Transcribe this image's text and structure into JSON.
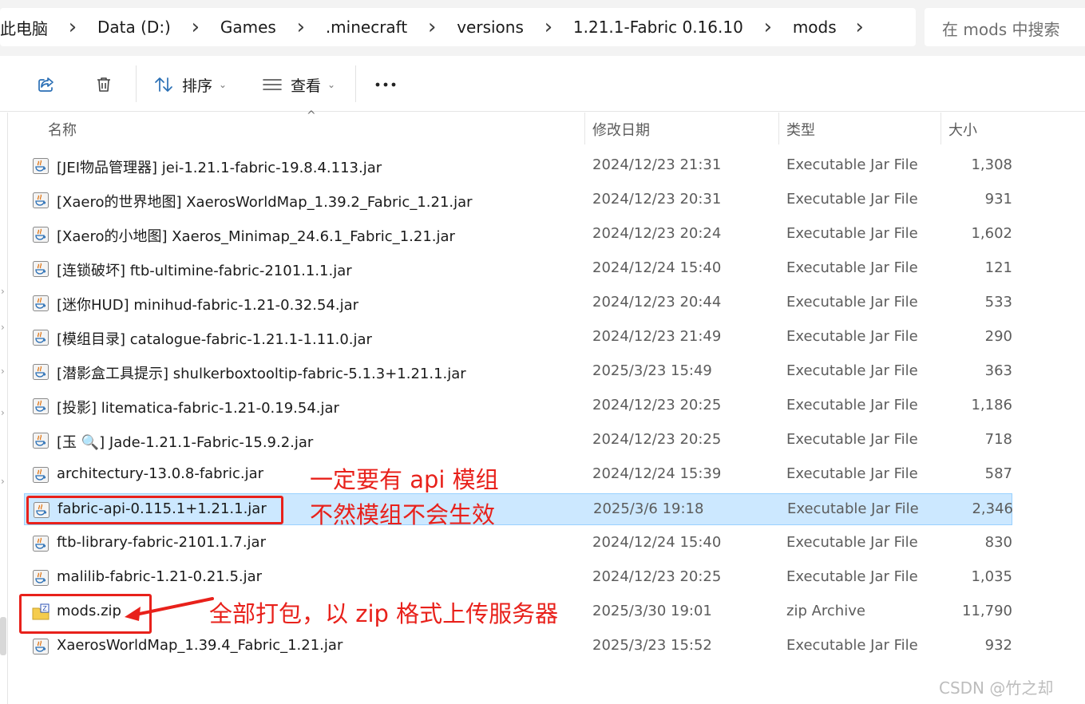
{
  "address_bar": {
    "breadcrumbs": [
      "此电脑",
      "Data (D:)",
      "Games",
      ".minecraft",
      "versions",
      "1.21.1-Fabric 0.16.10",
      "mods"
    ]
  },
  "search": {
    "placeholder": "在 mods 中搜索"
  },
  "toolbar": {
    "share_icon": "share-icon",
    "delete_icon": "trash-icon",
    "sort_label": "排序",
    "view_label": "查看",
    "more_label": "..."
  },
  "columns": {
    "name": "名称",
    "date": "修改日期",
    "type": "类型",
    "size": "大小"
  },
  "files": [
    {
      "name": "[JEI物品管理器] jei-1.21.1-fabric-19.8.4.113.jar",
      "date": "2024/12/23 21:31",
      "type": "Executable Jar File",
      "size": "1,308",
      "icon": "jar"
    },
    {
      "name": "[Xaero的世界地图] XaerosWorldMap_1.39.2_Fabric_1.21.jar",
      "date": "2024/12/23 20:31",
      "type": "Executable Jar File",
      "size": "931",
      "icon": "jar"
    },
    {
      "name": "[Xaero的小地图] Xaeros_Minimap_24.6.1_Fabric_1.21.jar",
      "date": "2024/12/23 20:24",
      "type": "Executable Jar File",
      "size": "1,602",
      "icon": "jar"
    },
    {
      "name": "[连锁破坏] ftb-ultimine-fabric-2101.1.1.jar",
      "date": "2024/12/24 15:40",
      "type": "Executable Jar File",
      "size": "121",
      "icon": "jar"
    },
    {
      "name": "[迷你HUD] minihud-fabric-1.21-0.32.54.jar",
      "date": "2024/12/23 20:44",
      "type": "Executable Jar File",
      "size": "533",
      "icon": "jar"
    },
    {
      "name": "[模组目录] catalogue-fabric-1.21.1-1.11.0.jar",
      "date": "2024/12/23 21:49",
      "type": "Executable Jar File",
      "size": "290",
      "icon": "jar"
    },
    {
      "name": "[潜影盒工具提示] shulkerboxtooltip-fabric-5.1.3+1.21.1.jar",
      "date": "2025/3/23 15:49",
      "type": "Executable Jar File",
      "size": "363",
      "icon": "jar"
    },
    {
      "name": "[投影] litematica-fabric-1.21-0.19.54.jar",
      "date": "2024/12/23 20:25",
      "type": "Executable Jar File",
      "size": "1,186",
      "icon": "jar"
    },
    {
      "name": "[玉 🔍] Jade-1.21.1-Fabric-15.9.2.jar",
      "date": "2024/12/23 20:25",
      "type": "Executable Jar File",
      "size": "718",
      "icon": "jar"
    },
    {
      "name": "architectury-13.0.8-fabric.jar",
      "date": "2024/12/24 15:39",
      "type": "Executable Jar File",
      "size": "587",
      "icon": "jar"
    },
    {
      "name": "fabric-api-0.115.1+1.21.1.jar",
      "date": "2025/3/6 19:18",
      "type": "Executable Jar File",
      "size": "2,346",
      "icon": "jar",
      "selected": true
    },
    {
      "name": "ftb-library-fabric-2101.1.7.jar",
      "date": "2024/12/24 15:40",
      "type": "Executable Jar File",
      "size": "830",
      "icon": "jar"
    },
    {
      "name": "malilib-fabric-1.21-0.21.5.jar",
      "date": "2024/12/23 20:25",
      "type": "Executable Jar File",
      "size": "1,035",
      "icon": "jar"
    },
    {
      "name": "mods.zip",
      "date": "2025/3/30 19:01",
      "type": "zip Archive",
      "size": "11,790",
      "icon": "zip"
    },
    {
      "name": "XaerosWorldMap_1.39.4_Fabric_1.21.jar",
      "date": "2025/3/23 15:52",
      "type": "Executable Jar File",
      "size": "932",
      "icon": "jar"
    }
  ],
  "annotations": {
    "api_line1": "一定要有 api 模组",
    "api_line2": "不然模组不会生效",
    "zip_note": "全部打包，以 zip 格式上传服务器",
    "color": "#e8211b"
  },
  "watermark": "CSDN @竹之却",
  "colors": {
    "selected_bg": "#cce8ff",
    "selected_border": "#99d1ff"
  }
}
